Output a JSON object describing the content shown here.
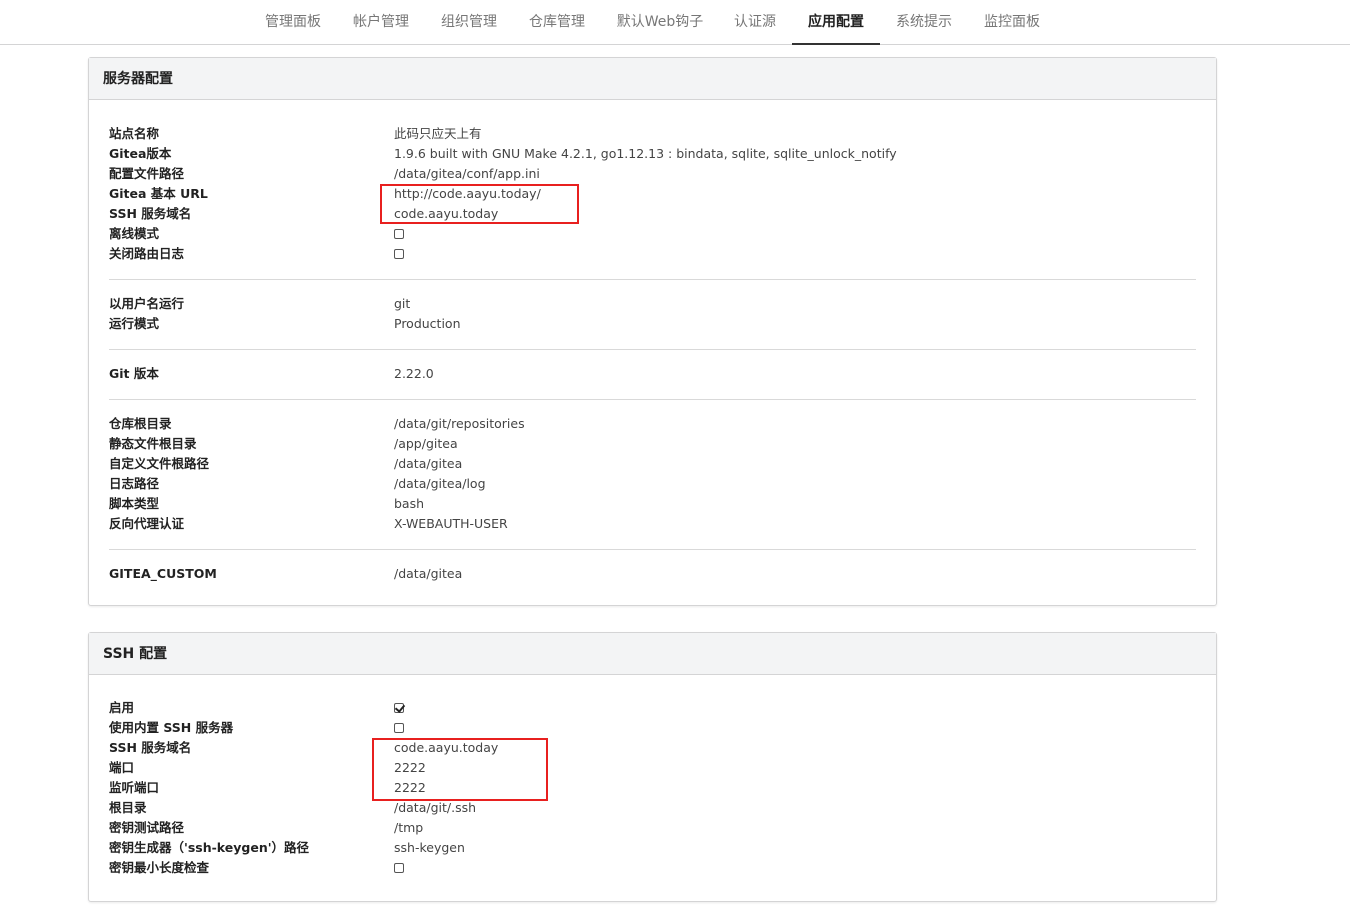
{
  "nav": {
    "tabs": [
      {
        "label": "管理面板"
      },
      {
        "label": "帐户管理"
      },
      {
        "label": "组织管理"
      },
      {
        "label": "仓库管理"
      },
      {
        "label": "默认Web钩子"
      },
      {
        "label": "认证源"
      },
      {
        "label": "应用配置",
        "active": true
      },
      {
        "label": "系统提示"
      },
      {
        "label": "监控面板"
      }
    ]
  },
  "server": {
    "title": "服务器配置",
    "rows": [
      {
        "key": "站点名称",
        "value": "此码只应天上有"
      },
      {
        "key": "Gitea版本",
        "value": "1.9.6 built with GNU Make 4.2.1, go1.12.13 : bindata, sqlite, sqlite_unlock_notify"
      },
      {
        "key": "配置文件路径",
        "value": "/data/gitea/conf/app.ini"
      },
      {
        "key": "Gitea 基本 URL",
        "value": "http://code.aayu.today/"
      },
      {
        "key": "SSH 服务域名",
        "value": "code.aayu.today"
      },
      {
        "key": "离线模式",
        "checked": false
      },
      {
        "key": "关闭路由日志",
        "checked": false
      },
      {
        "key": "以用户名运行",
        "value": "git"
      },
      {
        "key": "运行模式",
        "value": "Production"
      },
      {
        "key": "Git 版本",
        "value": "2.22.0"
      },
      {
        "key": "仓库根目录",
        "value": "/data/git/repositories"
      },
      {
        "key": "静态文件根目录",
        "value": "/app/gitea"
      },
      {
        "key": "自定义文件根路径",
        "value": "/data/gitea"
      },
      {
        "key": "日志路径",
        "value": "/data/gitea/log"
      },
      {
        "key": "脚本类型",
        "value": "bash"
      },
      {
        "key": "反向代理认证",
        "value": "X-WEBAUTH-USER"
      },
      {
        "key": "GITEA_CUSTOM",
        "value": "/data/gitea"
      }
    ]
  },
  "ssh": {
    "title": "SSH 配置",
    "rows": [
      {
        "key": "启用",
        "checked": true
      },
      {
        "key": "使用内置 SSH 服务器",
        "checked": false
      },
      {
        "key": "SSH 服务域名",
        "value": "code.aayu.today"
      },
      {
        "key": "端口",
        "value": "2222"
      },
      {
        "key": "监听端口",
        "value": "2222"
      },
      {
        "key": "根目录",
        "value": "/data/git/.ssh"
      },
      {
        "key": "密钥测试路径",
        "value": "/tmp"
      },
      {
        "key": "密钥生成器（'ssh-keygen'）路径",
        "value": "ssh-keygen"
      },
      {
        "key": "密钥最小长度检查",
        "checked": false
      }
    ]
  },
  "colors": {
    "highlight": "#e8201f",
    "header_bg": "#f3f4f5",
    "border": "#d4d4d5"
  }
}
